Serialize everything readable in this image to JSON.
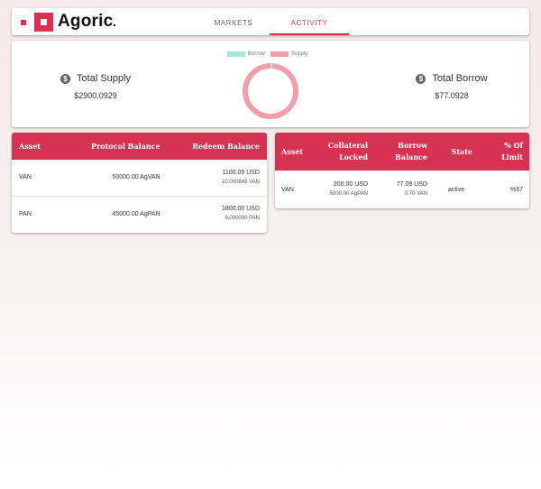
{
  "header": {
    "logo_text": "Agoric",
    "tabs": [
      {
        "label": "MARKETS",
        "active": false
      },
      {
        "label": "ACTIVITY",
        "active": true
      }
    ]
  },
  "summary": {
    "supply": {
      "title": "Total Supply",
      "value": "$2900.0929"
    },
    "borrow": {
      "title": "Total Borrow",
      "value": "$77.0928"
    },
    "legend": [
      {
        "label": "Borrow",
        "color": "#a5e6dc"
      },
      {
        "label": "Supply",
        "color": "#efa0ac"
      }
    ],
    "donut": {
      "supply": 2900.0929,
      "borrow": 77.0928
    }
  },
  "protocol_table": {
    "headers": [
      "Asset",
      "Protocol Balance",
      "Redeem Balance"
    ],
    "rows": [
      {
        "asset": "VAN",
        "protocol_balance": "50000.00 AgVAN",
        "redeem": "1100.09 USD",
        "redeem_sub": "10.000845 VAN"
      },
      {
        "asset": "PAN",
        "protocol_balance": "45000.00 AgPAN",
        "redeem": "1800.00 USD",
        "redeem_sub": "9.000000 PAN"
      }
    ]
  },
  "borrow_table": {
    "headers": [
      "Asset",
      "Collateral Locked",
      "Borrow Balance",
      "State",
      "% Of Limit"
    ],
    "rows": [
      {
        "asset": "VAN",
        "collateral": "200.00 USD",
        "collateral_sub": "5000.00 AgPAN",
        "borrow": "77.09 USD",
        "borrow_sub": "0.70 VAN",
        "state": "active",
        "limit": "%57"
      }
    ]
  },
  "colors": {
    "accent": "#d73252"
  }
}
